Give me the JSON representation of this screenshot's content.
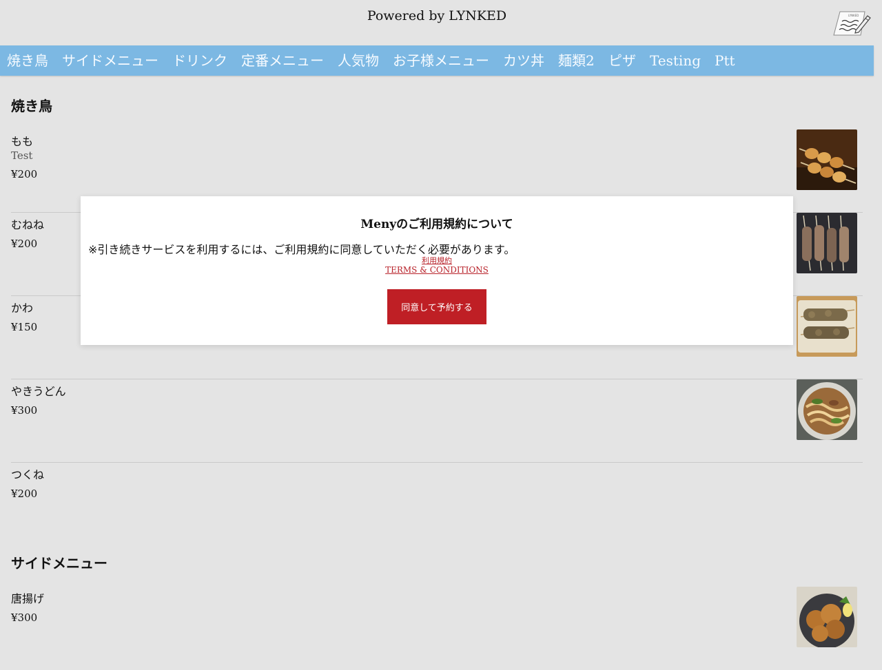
{
  "header": {
    "powered_by": "Powered by LYNKED",
    "logo_icon": "notepad-pencil-icon"
  },
  "nav": {
    "items": [
      "焼き鳥",
      "サイドメニュー",
      "ドリンク",
      "定番メニュー",
      "人気物",
      "お子様メニュー",
      "カツ丼",
      "麺類2",
      "ピザ",
      "Testing",
      "Ptt"
    ]
  },
  "sections": [
    {
      "title": "焼き鳥",
      "items": [
        {
          "name": "もも",
          "description": "Test",
          "price": "¥200",
          "image": "yakitori-momo-photo"
        },
        {
          "name": "むねね",
          "price": "¥200",
          "image": "yakitori-mune-photo"
        },
        {
          "name": "かわ",
          "price": "¥150",
          "image": "yakitori-kawa-photo"
        },
        {
          "name": "やきうどん",
          "price": "¥300",
          "image": "yaki-udon-photo"
        },
        {
          "name": "つくね",
          "price": "¥200"
        }
      ]
    },
    {
      "title": "サイドメニュー",
      "items": [
        {
          "name": "唐揚げ",
          "price": "¥300",
          "image": "karaage-photo"
        }
      ]
    }
  ],
  "modal": {
    "title": "Menyのご利用規約について",
    "note": "※引き続きサービスを利用するには、ご利用規約に同意していただく必要があります。",
    "link_ja": "利用規約",
    "link_en": "TERMS & CONDITIONS",
    "agree_button": "同意して予約する"
  },
  "colors": {
    "background": "#e4e4e4",
    "nav_bar": "#7cb8e3",
    "accent": "#bf1f25"
  }
}
